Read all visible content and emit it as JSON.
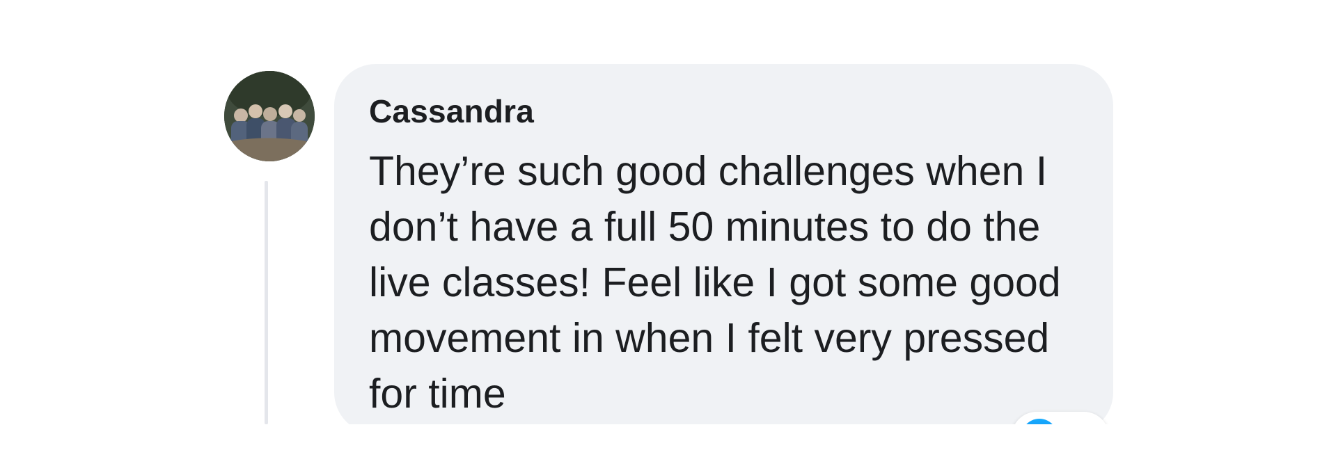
{
  "comment": {
    "author": "Cassandra",
    "text": "They’re such good challenges when I don’t have a full 50 minutes to do the live classes! Feel like I got some good movement in when I felt very pressed for time"
  },
  "reaction": {
    "icon": "like-icon",
    "color": "#0866ff"
  },
  "colors": {
    "bubble_background": "#f0f2f5",
    "thread_line": "#e4e6eb",
    "text": "#1c1e21"
  }
}
